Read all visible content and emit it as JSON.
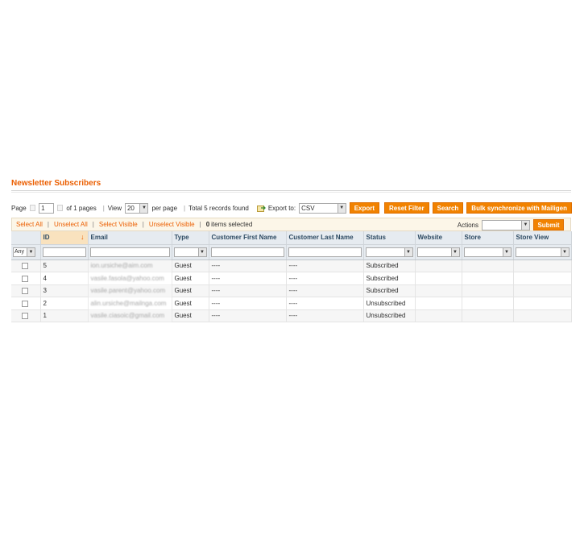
{
  "page_title": "Newsletter Subscribers",
  "pager": {
    "page_label": "Page",
    "page_value": "1",
    "of_pages": "of 1 pages",
    "view_label": "View",
    "per_page_value": "20",
    "per_page_label": "per page",
    "total": "Total 5 records found",
    "export_label": "Export to:",
    "export_format": "CSV",
    "export_button": "Export",
    "reset_filter_button": "Reset Filter",
    "search_button": "Search",
    "bulk_sync_button": "Bulk synchronize with Mailigen"
  },
  "massaction": {
    "select_all": "Select All",
    "unselect_all": "Unselect All",
    "select_visible": "Select Visible",
    "unselect_visible": "Unselect Visible",
    "selected_count": "0",
    "selected_label": "items selected",
    "actions_label": "Actions",
    "submit_button": "Submit"
  },
  "columns": [
    "",
    "ID",
    "Email",
    "Type",
    "Customer First Name",
    "Customer Last Name",
    "Status",
    "Website",
    "Store",
    "Store View"
  ],
  "filter": {
    "massaction_select": "Any"
  },
  "rows": [
    {
      "id": "5",
      "email": "ion.ursiche@aim.com",
      "type": "Guest",
      "first": "----",
      "last": "----",
      "status": "Subscribed"
    },
    {
      "id": "4",
      "email": "vasile.fasola@yahoo.com",
      "type": "Guest",
      "first": "----",
      "last": "----",
      "status": "Subscribed"
    },
    {
      "id": "3",
      "email": "vasile.parent@yahoo.com",
      "type": "Guest",
      "first": "----",
      "last": "----",
      "status": "Subscribed"
    },
    {
      "id": "2",
      "email": "alin.ursiche@mailnga.com",
      "type": "Guest",
      "first": "----",
      "last": "----",
      "status": "Unsubscribed"
    },
    {
      "id": "1",
      "email": "vasile.ciasoic@gmail.com",
      "type": "Guest",
      "first": "----",
      "last": "----",
      "status": "Unsubscribed"
    }
  ],
  "colors": {
    "accent": "#eb5e00",
    "button": "#f18200",
    "header_bg": "#e6ebf0",
    "sorted_header_bg": "#f9e2be"
  }
}
